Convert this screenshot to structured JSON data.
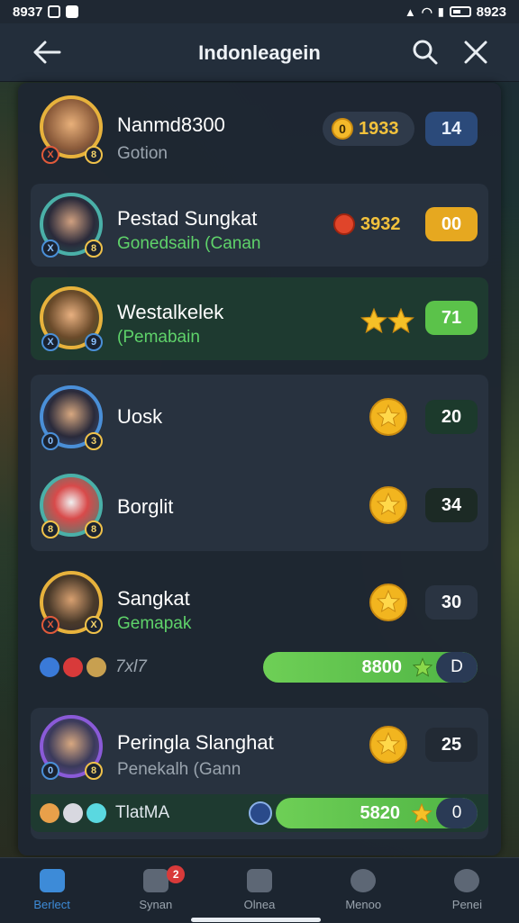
{
  "status_bar": {
    "time": "8937",
    "right_time": "8923"
  },
  "header": {
    "title": "Indonleagein",
    "back_icon": "back-arrow-icon",
    "search_icon": "search-icon",
    "close_icon": "close-icon"
  },
  "players": [
    {
      "name": "Nanmd8300",
      "subtitle": "Gotion",
      "coin_value": "1933",
      "rank": "14",
      "badge_left": "X",
      "badge_right": "8"
    },
    {
      "name": "Pestad Sungkat",
      "subtitle": "Gonedsaih (Canan",
      "coin_value": "3932",
      "rank": "00",
      "badge_left": "X",
      "badge_right": "8"
    },
    {
      "name": "Westalkelek",
      "subtitle": "(Pemabain",
      "rank": "71",
      "badge_left": "X",
      "badge_right": "9"
    },
    {
      "name": "Uosk",
      "rank": "20",
      "badge_left": "0",
      "badge_right": "3"
    },
    {
      "name": "Borglit",
      "rank": "34",
      "badge_left": "8",
      "badge_right": "8"
    },
    {
      "name": "Sangkat",
      "subtitle": "Gemapak",
      "rank": "30",
      "badge_left": "X",
      "badge_right": "X",
      "footer_label": "7xl7",
      "bar_value": "8800",
      "bar_cap": "D"
    },
    {
      "name": "Peringla Slanghat",
      "subtitle": "Penekalh (Gann",
      "rank": "25",
      "badge_left": "0",
      "badge_right": "8",
      "footer_label": "TlatMA",
      "bar_value": "5820",
      "bar_cap": "0"
    }
  ],
  "tabs": [
    {
      "label": "Berlect",
      "icon": "home-icon",
      "active": true
    },
    {
      "label": "Synan",
      "icon": "sword-icon",
      "badge": "2"
    },
    {
      "label": "Olnea",
      "icon": "chest-icon"
    },
    {
      "label": "Menoo",
      "icon": "profile-icon"
    },
    {
      "label": "Penei",
      "icon": "user-icon"
    }
  ],
  "colors": {
    "accent": "#3d8bd8",
    "gold": "#f3c23c",
    "green": "#5fd36a",
    "panel": "#1e2632"
  }
}
